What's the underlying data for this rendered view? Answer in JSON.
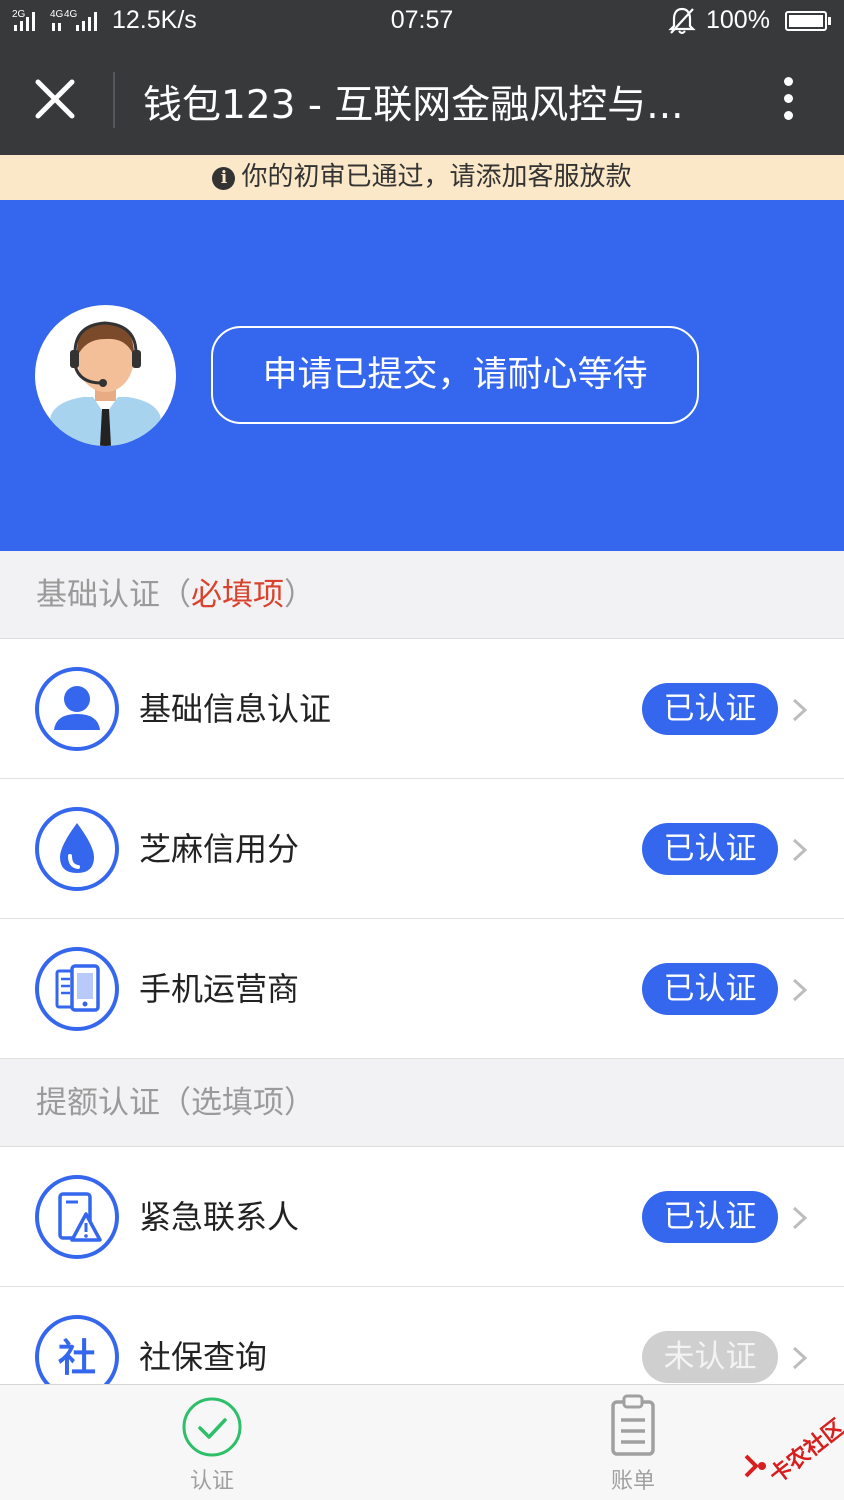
{
  "status_bar": {
    "network": "2G 4G 4G",
    "speed": "12.5K/s",
    "time": "07:57",
    "battery": "100%"
  },
  "title_bar": {
    "title": "钱包123 - 互联网金融风控与..."
  },
  "notice": {
    "text": "你的初审已通过，请添加客服放款"
  },
  "hero": {
    "status": "申请已提交，请耐心等待",
    "background_color": "#3566ee"
  },
  "sections": [
    {
      "title_prefix": "基础认证（",
      "title_highlight": "必填项",
      "title_suffix": "）",
      "items": [
        {
          "label": "基础信息认证",
          "status": "已认证",
          "icon": "person-icon"
        },
        {
          "label": "芝麻信用分",
          "status": "已认证",
          "icon": "sesame-drop-icon"
        },
        {
          "label": "手机运营商",
          "status": "已认证",
          "icon": "phone-carrier-icon"
        }
      ]
    },
    {
      "title_prefix": "提额认证（选填项）",
      "title_highlight": "",
      "title_suffix": "",
      "items": [
        {
          "label": "紧急联系人",
          "status": "已认证",
          "icon": "emergency-contact-icon"
        },
        {
          "label": "社保查询",
          "status": "未认证",
          "icon": "social-security-icon"
        }
      ]
    }
  ],
  "tabbar": {
    "tabs": [
      {
        "label": "认证",
        "icon": "check-circle-icon"
      },
      {
        "label": "账单",
        "icon": "clipboard-icon"
      }
    ]
  },
  "watermark": {
    "text": "卡农社区"
  }
}
